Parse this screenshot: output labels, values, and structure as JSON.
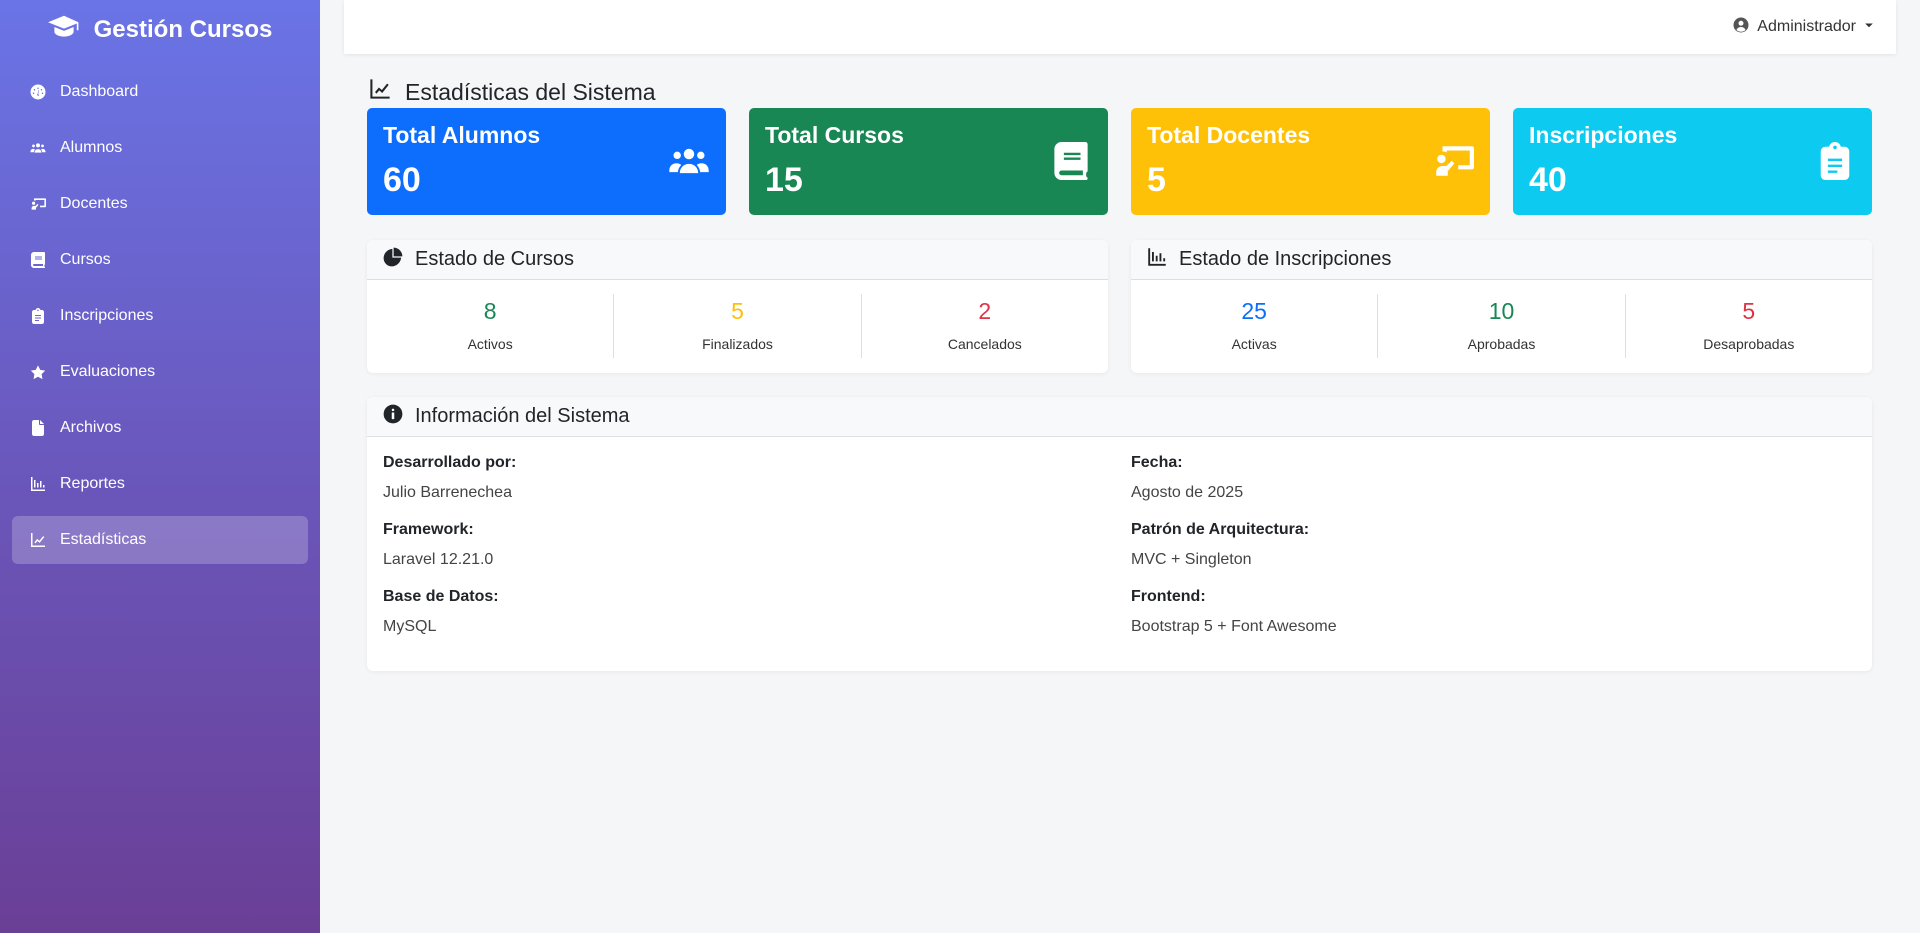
{
  "app": {
    "brand": "Gestión Cursos"
  },
  "sidebar": {
    "items": [
      {
        "label": "Dashboard",
        "icon": "dashboard-icon"
      },
      {
        "label": "Alumnos",
        "icon": "users-icon"
      },
      {
        "label": "Docentes",
        "icon": "teacher-icon"
      },
      {
        "label": "Cursos",
        "icon": "book-icon"
      },
      {
        "label": "Inscripciones",
        "icon": "clipboard-icon"
      },
      {
        "label": "Evaluaciones",
        "icon": "star-icon"
      },
      {
        "label": "Archivos",
        "icon": "file-icon"
      },
      {
        "label": "Reportes",
        "icon": "bar-chart-icon"
      },
      {
        "label": "Estadísticas",
        "icon": "line-chart-icon",
        "active": true
      }
    ]
  },
  "topbar": {
    "user": "Administrador"
  },
  "page": {
    "title": "Estadísticas del Sistema"
  },
  "cards": [
    {
      "label": "Total Alumnos",
      "value": "60",
      "color": "#0d6efd",
      "icon": "users-icon"
    },
    {
      "label": "Total Cursos",
      "value": "15",
      "color": "#198754",
      "icon": "book-icon"
    },
    {
      "label": "Total Docentes",
      "value": "5",
      "color": "#ffc107",
      "icon": "teacher-icon"
    },
    {
      "label": "Inscripciones",
      "value": "40",
      "color": "#0dcaf0",
      "icon": "clipboard-icon"
    }
  ],
  "cursos_status": {
    "title": "Estado de Cursos",
    "items": [
      {
        "value": "8",
        "label": "Activos",
        "color": "#198754"
      },
      {
        "value": "5",
        "label": "Finalizados",
        "color": "#ffc107"
      },
      {
        "value": "2",
        "label": "Cancelados",
        "color": "#dc3545"
      }
    ]
  },
  "inscripciones_status": {
    "title": "Estado de Inscripciones",
    "items": [
      {
        "value": "25",
        "label": "Activas",
        "color": "#0d6efd"
      },
      {
        "value": "10",
        "label": "Aprobadas",
        "color": "#198754"
      },
      {
        "value": "5",
        "label": "Desaprobadas",
        "color": "#dc3545"
      }
    ]
  },
  "info": {
    "title": "Información del Sistema",
    "left": [
      {
        "key": "Desarrollado por:",
        "value": "Julio Barrenechea"
      },
      {
        "key": "Framework:",
        "value": "Laravel 12.21.0"
      },
      {
        "key": "Base de Datos:",
        "value": "MySQL"
      }
    ],
    "right": [
      {
        "key": "Fecha:",
        "value": "Agosto de 2025"
      },
      {
        "key": "Patrón de Arquitectura:",
        "value": "MVC + Singleton"
      },
      {
        "key": "Frontend:",
        "value": "Bootstrap 5 + Font Awesome"
      }
    ]
  }
}
